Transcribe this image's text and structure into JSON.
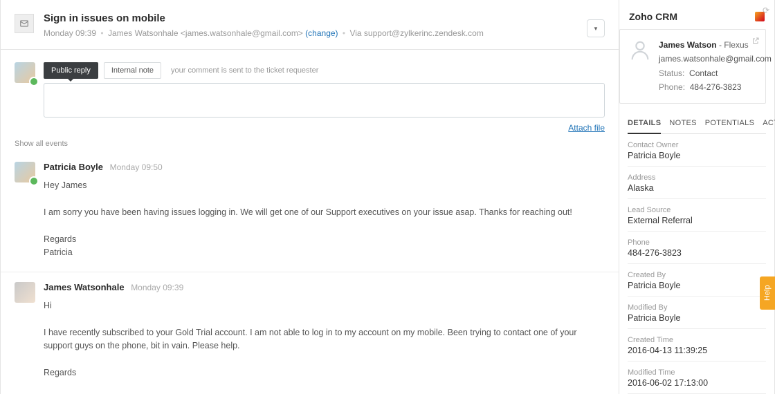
{
  "ticket": {
    "title": "Sign in issues on mobile",
    "time": "Monday 09:39",
    "requester": "James Watsonhale <james.watsonhale@gmail.com>",
    "change_label": "(change)",
    "via_label": "Via",
    "via_address": "support@zylkerinc.zendesk.com"
  },
  "reply": {
    "tabs": {
      "public": "Public reply",
      "internal": "Internal note"
    },
    "hint": "your comment is sent to the ticket requester",
    "attach": "Attach file"
  },
  "events_label": "Show all events",
  "messages": [
    {
      "author": "Patricia Boyle",
      "time": "Monday 09:50",
      "text": "Hey James\n\nI am sorry you have been having issues logging in. We will get one of our Support executives on your issue asap. Thanks for reaching out!\n\nRegards\nPatricia"
    },
    {
      "author": "James Watsonhale",
      "time": "Monday 09:39",
      "text": "Hi\n\nI have recently subscribed to your Gold Trial account. I am not able to log in to my account on my mobile. Been trying to contact one of your support guys on the phone, bit in vain. Please help.\n\nRegards"
    }
  ],
  "sidebar": {
    "app_title": "Zoho CRM",
    "contact": {
      "name": "James Watson",
      "company": "Flexus",
      "email": "james.watsonhale@gmail.com",
      "status_label": "Status:",
      "status_value": "Contact",
      "phone_label": "Phone:",
      "phone_value": "484-276-3823"
    },
    "tabs": {
      "details": "DETAILS",
      "notes": "NOTES",
      "potentials": "POTENTIALS",
      "activities": "ACTIVITIES"
    },
    "details": [
      {
        "label": "Contact Owner",
        "value": "Patricia Boyle"
      },
      {
        "label": "Address",
        "value": "Alaska"
      },
      {
        "label": "Lead Source",
        "value": "External Referral"
      },
      {
        "label": "Phone",
        "value": "484-276-3823"
      },
      {
        "label": "Created By",
        "value": "Patricia Boyle"
      },
      {
        "label": "Modified By",
        "value": "Patricia Boyle"
      },
      {
        "label": "Created Time",
        "value": "2016-04-13 11:39:25"
      },
      {
        "label": "Modified Time",
        "value": "2016-06-02 17:13:00"
      }
    ]
  },
  "help_label": "Help"
}
